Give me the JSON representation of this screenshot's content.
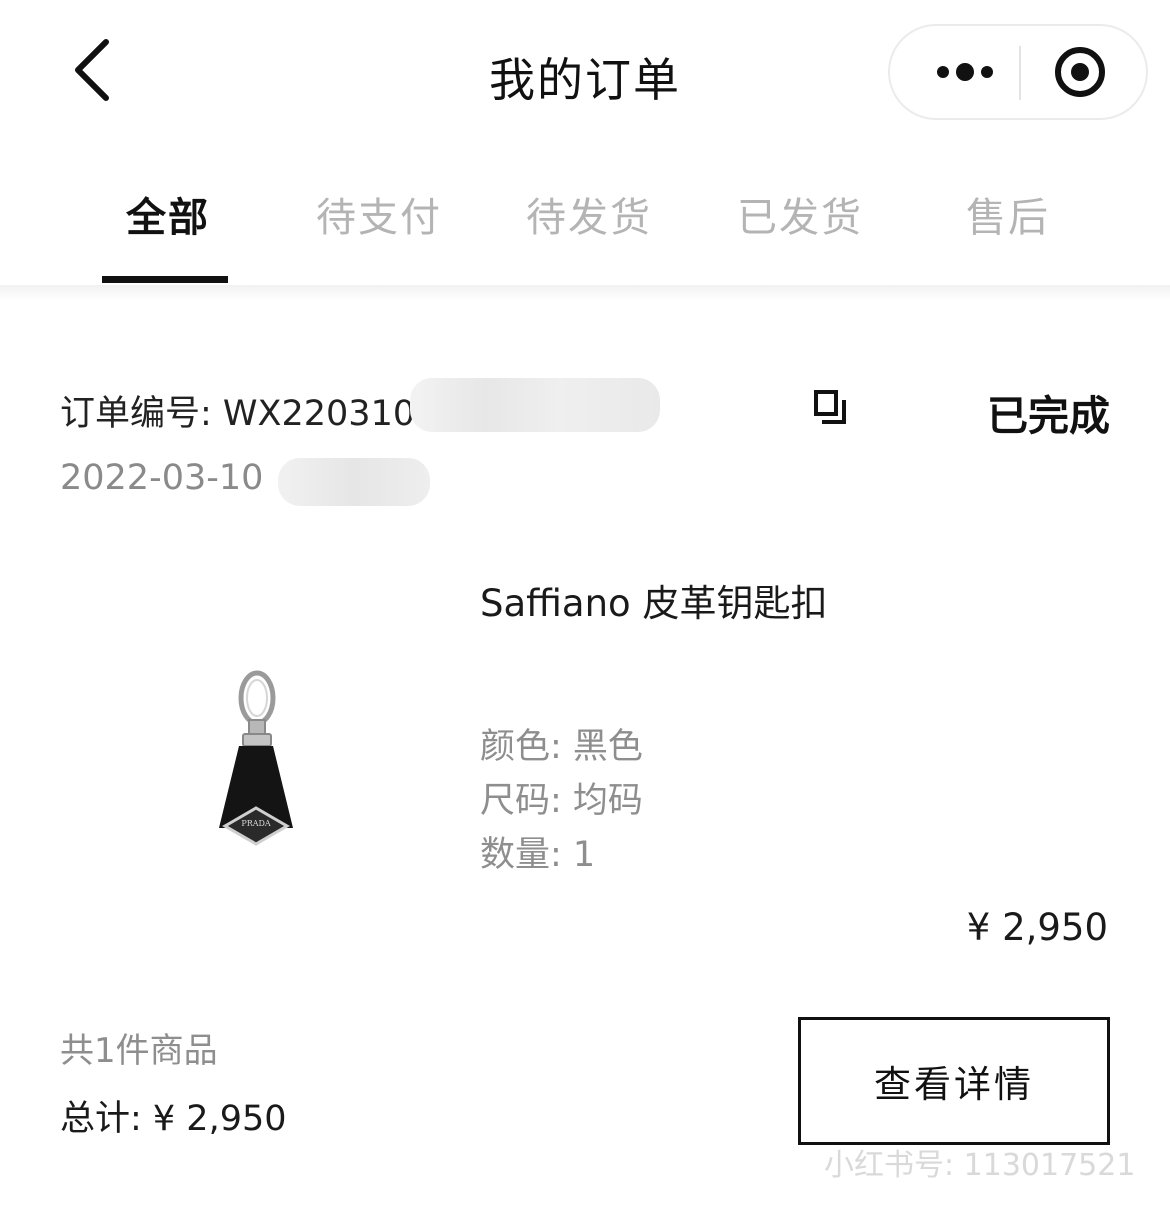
{
  "header": {
    "title": "我的订单",
    "back_icon": "chevron-left-icon",
    "more_icon": "more-dots-icon",
    "close_icon": "target-circle-icon"
  },
  "tabs": [
    {
      "label": "全部",
      "active": true
    },
    {
      "label": "待支付",
      "active": false
    },
    {
      "label": "待发货",
      "active": false
    },
    {
      "label": "已发货",
      "active": false
    },
    {
      "label": "售后",
      "active": false
    }
  ],
  "order": {
    "number": "订单编号: WX2203101",
    "date": "2022-03-10",
    "status": "已完成",
    "copy_icon": "copy-icon",
    "product": {
      "name": "Saffiano 皮革钥匙扣",
      "image_icon": "keychain-image",
      "brand_mark": "PRADA",
      "color": "颜色: 黑色",
      "size": "尺码: 均码",
      "quantity": "数量: 1",
      "price": "¥ 2,950"
    },
    "item_count": "共1件商品",
    "total": "总计: ¥ 2,950",
    "detail_button": "查看详情"
  },
  "watermark": "小红书号: 113017521",
  "colors": {
    "primary_text": "#111111",
    "secondary_text": "#8e8e8e",
    "inactive_tab": "#b4b4b4",
    "background": "#ffffff"
  }
}
